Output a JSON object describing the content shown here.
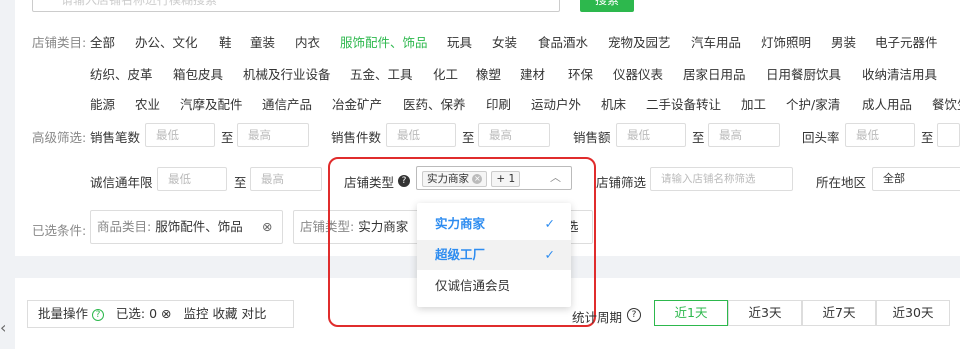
{
  "search": {
    "placeholder_text": "请输入店铺名称进行模糊搜索",
    "button_label": "搜索"
  },
  "category": {
    "label": "店铺类目:",
    "row1": [
      "全部",
      "办公、文化",
      "鞋",
      "童装",
      "内衣",
      "服饰配件、饰品",
      "玩具",
      "女装",
      "食品酒水",
      "宠物及园艺",
      "汽车用品",
      "灯饰照明",
      "男装",
      "电子元器件"
    ],
    "row2": [
      "纺织、皮革",
      "箱包皮具",
      "机械及行业设备",
      "五金、工具",
      "化工",
      "橡塑",
      "建材",
      "环保",
      "仪器仪表",
      "居家日用品",
      "日用餐厨饮具",
      "收纳清洁用具"
    ],
    "row3": [
      "能源",
      "农业",
      "汽摩及配件",
      "通信产品",
      "冶金矿产",
      "医药、保养",
      "印刷",
      "运动户外",
      "机床",
      "二手设备转让",
      "加工",
      "个护/家清",
      "成人用品",
      "餐饮生"
    ]
  },
  "advanced": {
    "label": "高级筛选:",
    "filters": [
      {
        "label": "销售笔数",
        "min": "最低",
        "max": "最高"
      },
      {
        "label": "销售件数",
        "min": "最低",
        "max": "最高"
      },
      {
        "label": "销售额",
        "min": "最低",
        "max": "最高"
      },
      {
        "label": "回头率",
        "min": "最低",
        "max": ""
      }
    ],
    "to": "至"
  },
  "years": {
    "label": "诚信通年限",
    "min": "最低",
    "max": "最高"
  },
  "store_type": {
    "label": "店铺类型",
    "help": "?",
    "chip": "实力商家",
    "chip_close": "×",
    "more": "+ 1",
    "caret": "︿",
    "options": [
      {
        "label": "实力商家",
        "selected": true
      },
      {
        "label": "超级工厂",
        "selected": true
      },
      {
        "label": "仅诚信通会员",
        "selected": false
      }
    ],
    "check": "✓"
  },
  "store_filter": {
    "label": "店铺筛选",
    "placeholder": "请输入店铺名称筛选"
  },
  "region": {
    "label": "所在地区",
    "value": "全部"
  },
  "selected": {
    "label": "已选条件:",
    "tag1_key": "商品类目:",
    "tag1_value": "服饰配件、饰品",
    "tag2_key": "店铺类型:",
    "tag2_value": "实力商家",
    "tag2_tail": "选"
  },
  "bulk": {
    "label": "批量操作",
    "help": "?",
    "selected": "已选: 0",
    "clear": "⊗",
    "monitor": "监控",
    "favorite": "收藏",
    "compare": "对比"
  },
  "period": {
    "label": "统计周期",
    "help": "?",
    "options": [
      "近1天",
      "近3天",
      "近7天",
      "近30天"
    ],
    "active": "近1天"
  },
  "nav": {
    "left_arrow": "‹"
  },
  "colors": {
    "accent": "#2db84d",
    "highlight": "#2d8cf0",
    "frame": "#e02c2c"
  }
}
